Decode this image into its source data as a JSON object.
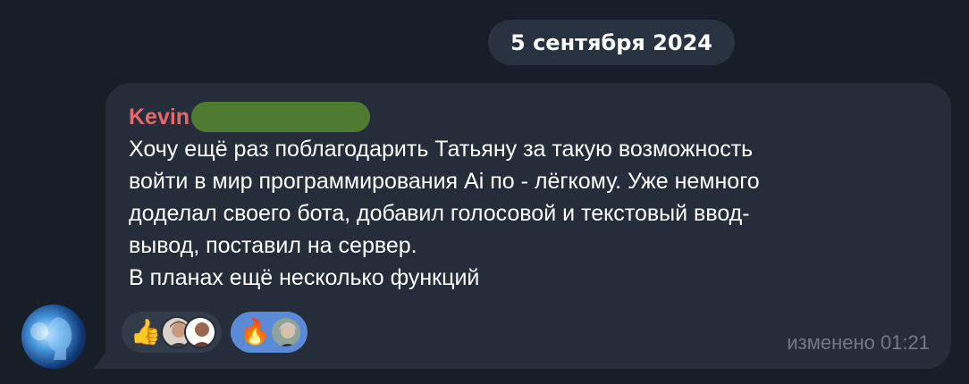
{
  "date_separator": "5 сентября 2024",
  "message": {
    "sender_name": "Kevin",
    "lines": [
      "Хочу ещё раз поблагодарить Татьяну за такую возможность",
      "войти в мир программирования Ai по - лёгкому. Уже немного",
      "доделал своего бота, добавил голосовой и текстовый ввод-",
      "вывод, поставил на сервер.",
      "В планах ещё несколько функций"
    ],
    "edited_label": "изменено 01:21"
  },
  "reactions": [
    {
      "emoji": "👍",
      "icon": "thumbs-up-icon",
      "chosen": false,
      "avatar_count": 2
    },
    {
      "emoji": "🔥",
      "icon": "fire-icon",
      "chosen": true,
      "avatar_count": 1
    }
  ],
  "colors": {
    "background": "#181e27",
    "bubble": "#252d3a",
    "sender_name": "#e26a6a",
    "chosen_reaction": "#5b8bd6",
    "meta_text": "#6f7a88"
  }
}
